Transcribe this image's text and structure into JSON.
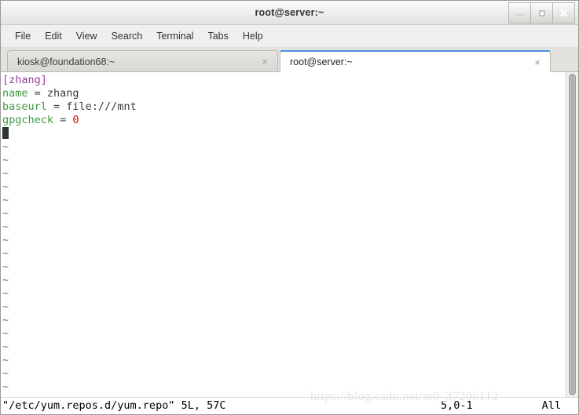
{
  "window": {
    "title": "root@server:~",
    "controls": [
      {
        "name": "minimize",
        "glyph": "minimize-icon"
      },
      {
        "name": "maximize",
        "glyph": "maximize-icon"
      },
      {
        "name": "close",
        "glyph": "close-icon"
      }
    ]
  },
  "menubar": {
    "items": [
      {
        "label": "File"
      },
      {
        "label": "Edit"
      },
      {
        "label": "View"
      },
      {
        "label": "Search"
      },
      {
        "label": "Terminal"
      },
      {
        "label": "Tabs"
      },
      {
        "label": "Help"
      }
    ]
  },
  "tabs": [
    {
      "label": "kiosk@foundation68:~",
      "active": false,
      "close": "×"
    },
    {
      "label": "root@server:~",
      "active": true,
      "close": "×"
    }
  ],
  "terminal": {
    "editor": "vim",
    "lines": [
      {
        "type": "section",
        "text": "[zhang]"
      },
      {
        "type": "kv",
        "key": "name",
        "sep": " = ",
        "value": "zhang",
        "value_kind": "plain"
      },
      {
        "type": "kv",
        "key": "baseurl",
        "sep": " = ",
        "value": "file:///mnt",
        "value_kind": "plain"
      },
      {
        "type": "kv",
        "key": "gpgcheck",
        "sep": " = ",
        "value": "0",
        "value_kind": "number"
      },
      {
        "type": "cursor",
        "text": ""
      }
    ],
    "filler_char": "~",
    "filler_count": 21,
    "colors": {
      "background": "#ffffff",
      "section": "#a03ca0",
      "key": "#3f9a3f",
      "plain": "#3b3b3b",
      "number": "#cc1414",
      "tilde": "#5c7fbd",
      "cursor": "#2e3436"
    }
  },
  "statusline": {
    "file_info": "\"/etc/yum.repos.d/yum.repo\" 5L, 57C",
    "position": "5,0-1",
    "scroll_indicator": "All"
  },
  "watermark": {
    "text": "https://blog.csdn.net/m0_37206112"
  }
}
